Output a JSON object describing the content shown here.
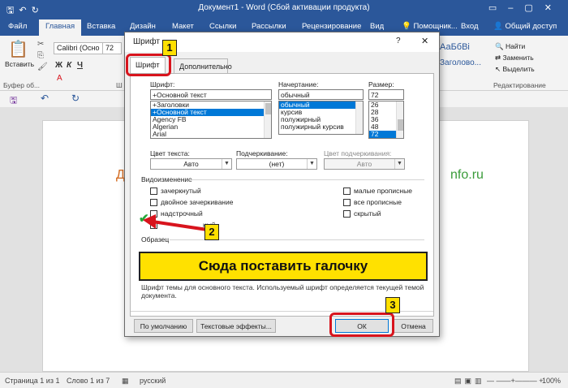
{
  "window": {
    "title": "Документ1 - Word (Сбой активации продукта)"
  },
  "ribbon_tabs": [
    "Файл",
    "Главная",
    "Вставка",
    "Дизайн",
    "Макет",
    "Ссылки",
    "Рассылки",
    "Рецензирование",
    "Вид"
  ],
  "tell_me": "Помощник...",
  "account": {
    "sign_in": "Вход",
    "share": "Общий доступ"
  },
  "ribbon": {
    "paste": "Вставить",
    "clipboard_group": "Буфер об...",
    "font_name": "Calibri (Осно",
    "font_size": "72",
    "font_group_cut": "Ш",
    "styles": [
      "АаБбВі",
      "Заголово..."
    ],
    "edit": {
      "find": "Найти",
      "replace": "Заменить",
      "select": "Выделить"
    },
    "edit_group": "Редактирование"
  },
  "document": {
    "text_left": "Д",
    "text_right": "nfo.ru"
  },
  "status": {
    "page": "Страница 1 из 1",
    "words": "Слово 1 из 7",
    "lang": "русский",
    "zoom": "100%"
  },
  "dialog": {
    "title": "Шрифт",
    "help": "?",
    "close": "✕",
    "tabs": [
      "Шрифт",
      "Дополнительно"
    ],
    "font_label": "Шрифт:",
    "font_value": "+Основной текст",
    "font_list": [
      "+Заголовки",
      "+Основной текст",
      "Agency FB",
      "Algerian",
      "Arial"
    ],
    "style_label": "Начертание:",
    "style_value": "обычный",
    "style_list": [
      "обычный",
      "курсив",
      "полужирный",
      "полужирный курсив"
    ],
    "size_label": "Размер:",
    "size_value": "72",
    "size_list": [
      "26",
      "28",
      "36",
      "48",
      "72"
    ],
    "color_label": "Цвет текста:",
    "color_value": "Авто",
    "underline_label": "Подчеркивание:",
    "underline_value": "(нет)",
    "underline_color_label": "Цвет подчеркивания:",
    "underline_color_value": "Авто",
    "effects_label": "Видоизменение",
    "effects_left": [
      "зачеркнутый",
      "двойное зачеркивание",
      "надстрочный",
      "подстрочный"
    ],
    "effects_left_visible": [
      "зачеркнутый",
      "двойное зачеркивание",
      "надстрочный",
      "",
      "ный"
    ],
    "effects_right": [
      "малые прописные",
      "все прописные",
      "скрытый"
    ],
    "sample_label": "Образец",
    "description_1": "Шрифт темы для основного текста. Используемый шрифт определяется текущей темой",
    "description_2": "документа.",
    "buttons": {
      "default": "По умолчанию",
      "effects": "Текстовые эффекты...",
      "ok": "ОК",
      "cancel": "Отмена"
    }
  },
  "annotations": {
    "badge_1": "1",
    "badge_2": "2",
    "badge_3": "3",
    "banner": "Сюда поставить галочку"
  },
  "colors": {
    "word_blue": "#2b579a",
    "annotation_red": "#d8141d",
    "annotation_yellow": "#ffe100",
    "check_green": "#24a83a"
  }
}
